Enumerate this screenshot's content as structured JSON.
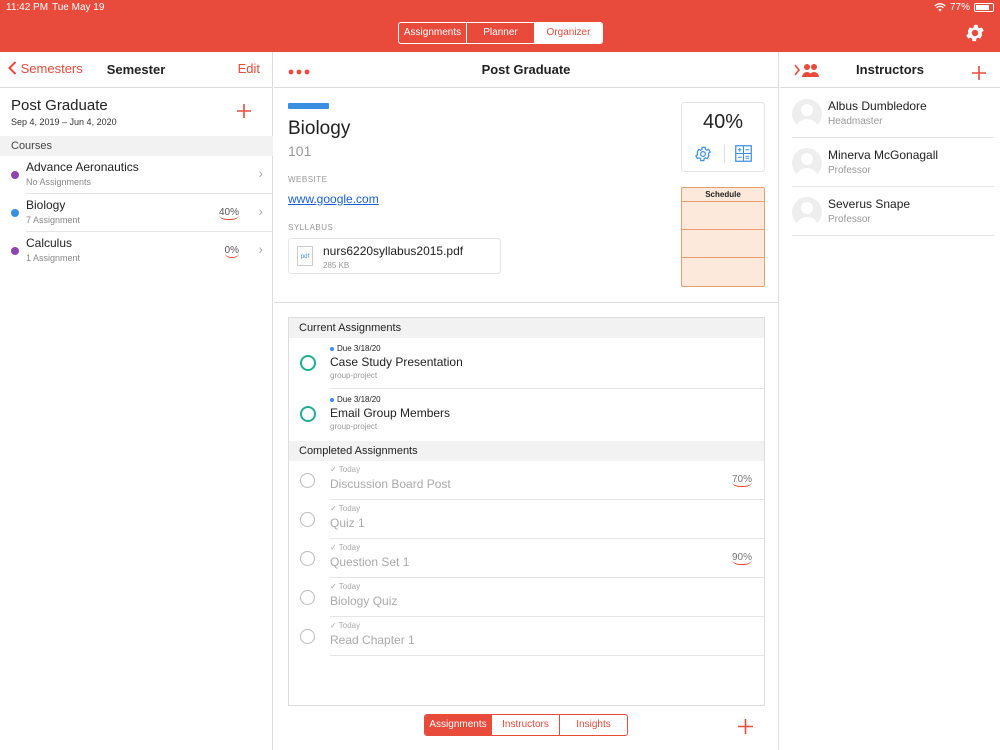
{
  "status": {
    "time": "11:42 PM",
    "date": "Tue May 19",
    "battery": "77%"
  },
  "top_tabs": [
    {
      "label": "Assignments",
      "active": false
    },
    {
      "label": "Planner",
      "active": false
    },
    {
      "label": "Organizer",
      "active": true
    }
  ],
  "left": {
    "back_label": "Semesters",
    "title": "Semester",
    "edit_label": "Edit",
    "semester_name": "Post Graduate",
    "semester_dates": "Sep 4, 2019 – Jun 4, 2020",
    "courses_label": "Courses",
    "courses": [
      {
        "name": "Advance Aeronautics",
        "sub": "No Assignments",
        "grade": "",
        "color": "#8E44AD"
      },
      {
        "name": "Biology",
        "sub": "7 Assignment",
        "grade": "40%",
        "color": "#3B8FE0"
      },
      {
        "name": "Calculus",
        "sub": "1 Assignment",
        "grade": "0%",
        "color": "#8E44AD"
      }
    ]
  },
  "mid": {
    "title": "Post Graduate",
    "course_title": "Biology",
    "course_number": "101",
    "course_color": "#3B8FE0",
    "website_label": "WEBSITE",
    "website": "www.google.com",
    "syllabus_label": "SYLLABUS",
    "file_type": "pdf",
    "file_name": "nurs6220syllabus2015.pdf",
    "file_size": "285 KB",
    "grade": "40%",
    "schedule_title": "Schedule",
    "current_label": "Current Assignments",
    "current": [
      {
        "due": "Due 3/18/20",
        "name": "Case Study Presentation",
        "tag": "group-project"
      },
      {
        "due": "Due 3/18/20",
        "name": "Email Group Members",
        "tag": "group-project"
      }
    ],
    "completed_label": "Completed Assignments",
    "completed": [
      {
        "due": "Today",
        "name": "Discussion Board Post",
        "grade": "70%"
      },
      {
        "due": "Today",
        "name": "Quiz 1",
        "grade": ""
      },
      {
        "due": "Today",
        "name": "Question Set 1",
        "grade": "90%"
      },
      {
        "due": "Today",
        "name": "Biology Quiz",
        "grade": ""
      },
      {
        "due": "Today",
        "name": "Read Chapter 1",
        "grade": ""
      }
    ],
    "bottom_tabs": [
      {
        "label": "Assignments",
        "active": true
      },
      {
        "label": "Instructors",
        "active": false
      },
      {
        "label": "Insights",
        "active": false
      }
    ]
  },
  "right": {
    "title": "Instructors",
    "instructors": [
      {
        "name": "Albus Dumbledore",
        "role": "Headmaster"
      },
      {
        "name": "Minerva McGonagall",
        "role": "Professor"
      },
      {
        "name": "Severus Snape",
        "role": "Professor"
      }
    ]
  },
  "colors": {
    "accent": "#E84B3C",
    "complete_ring": "#1FAE8E",
    "link": "#1A5FD6"
  }
}
